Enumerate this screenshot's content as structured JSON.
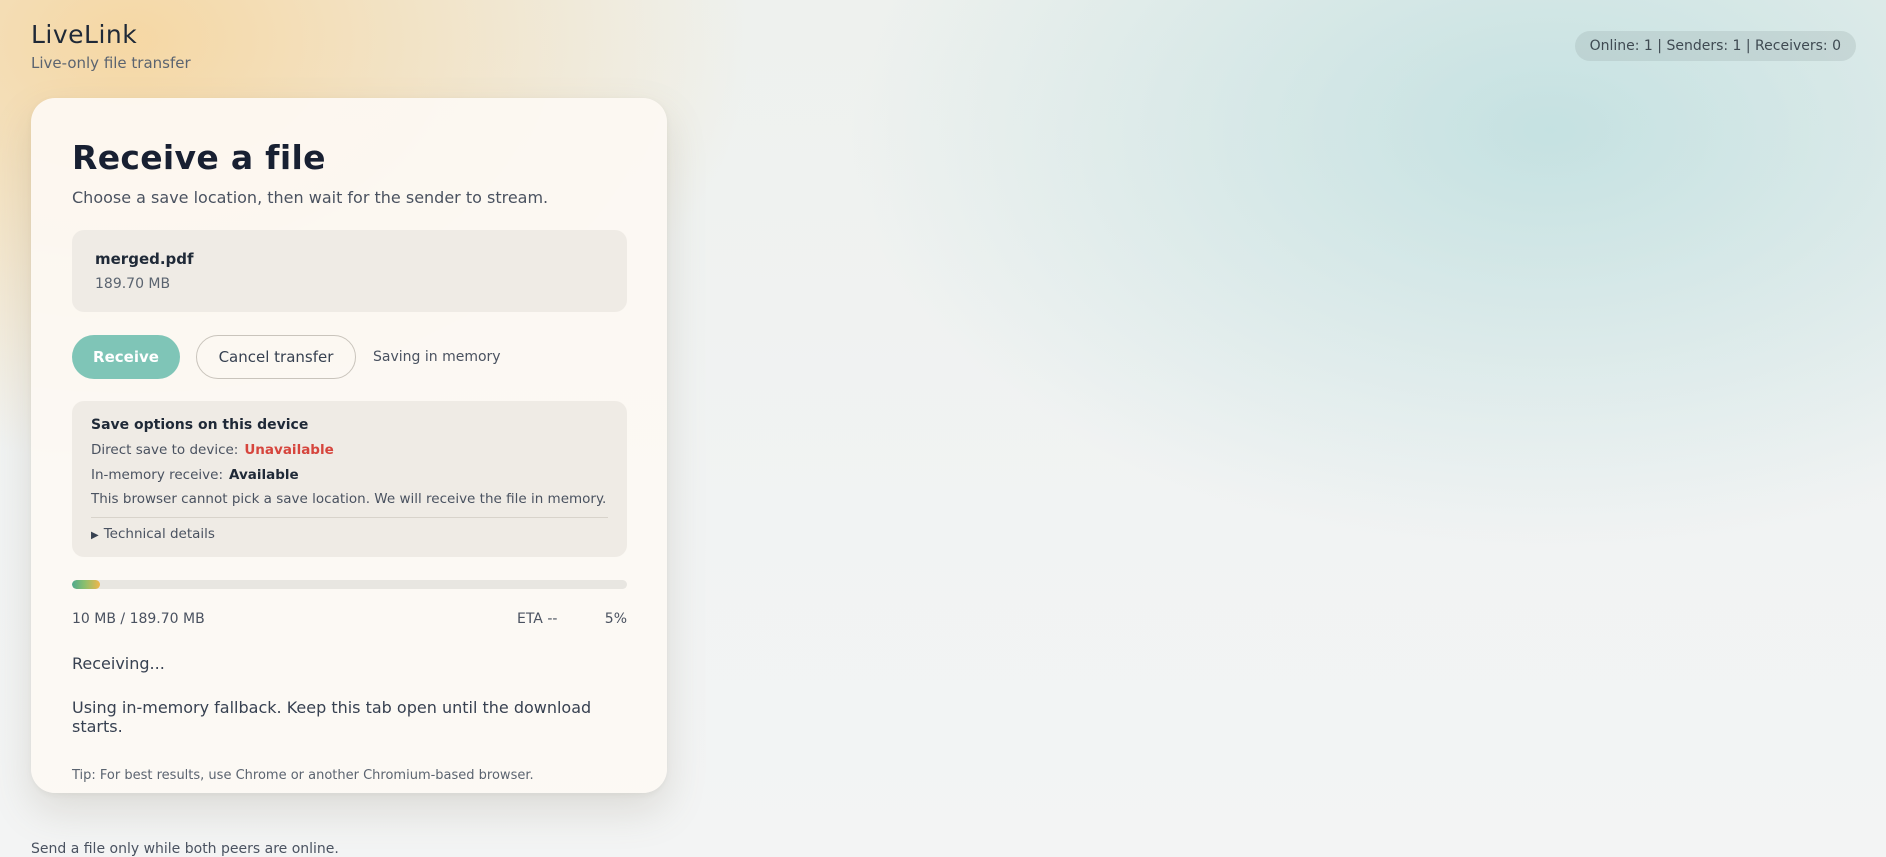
{
  "app": {
    "title": "LiveLink",
    "subtitle": "Live-only file transfer"
  },
  "status_bar": {
    "text": "Online: 1 | Senders: 1 | Receivers: 0"
  },
  "card": {
    "title": "Receive a file",
    "subtitle": "Choose a save location, then wait for the sender to stream.",
    "file": {
      "name": "merged.pdf",
      "size": "189.70 MB"
    },
    "actions": {
      "receive_label": "Receive",
      "cancel_label": "Cancel transfer",
      "saving_mode": "Saving in memory"
    },
    "save_options": {
      "title": "Save options on this device",
      "direct_save_label": "Direct save to device:",
      "direct_save_value": "Unavailable",
      "in_memory_label": "In-memory receive:",
      "in_memory_value": "Available",
      "note": "This browser cannot pick a save location. We will receive the file in memory.",
      "technical_details_label": "Technical details"
    },
    "progress": {
      "fraction": 0.05,
      "transferred": "10 MB / 189.70 MB",
      "eta": "ETA --",
      "percent": "5%"
    },
    "receive_status": "Receiving...",
    "fallback_note": "Using in-memory fallback. Keep this tab open until the download starts.",
    "tip": "Tip: For best results, use Chrome or another Chromium-based browser."
  },
  "footer": {
    "note": "Send a file only while both peers are online."
  },
  "colors": {
    "accent": "#7fc5b7",
    "danger": "#d6453d",
    "progress_start": "#4fa98d",
    "progress_end": "#f0b64b"
  }
}
